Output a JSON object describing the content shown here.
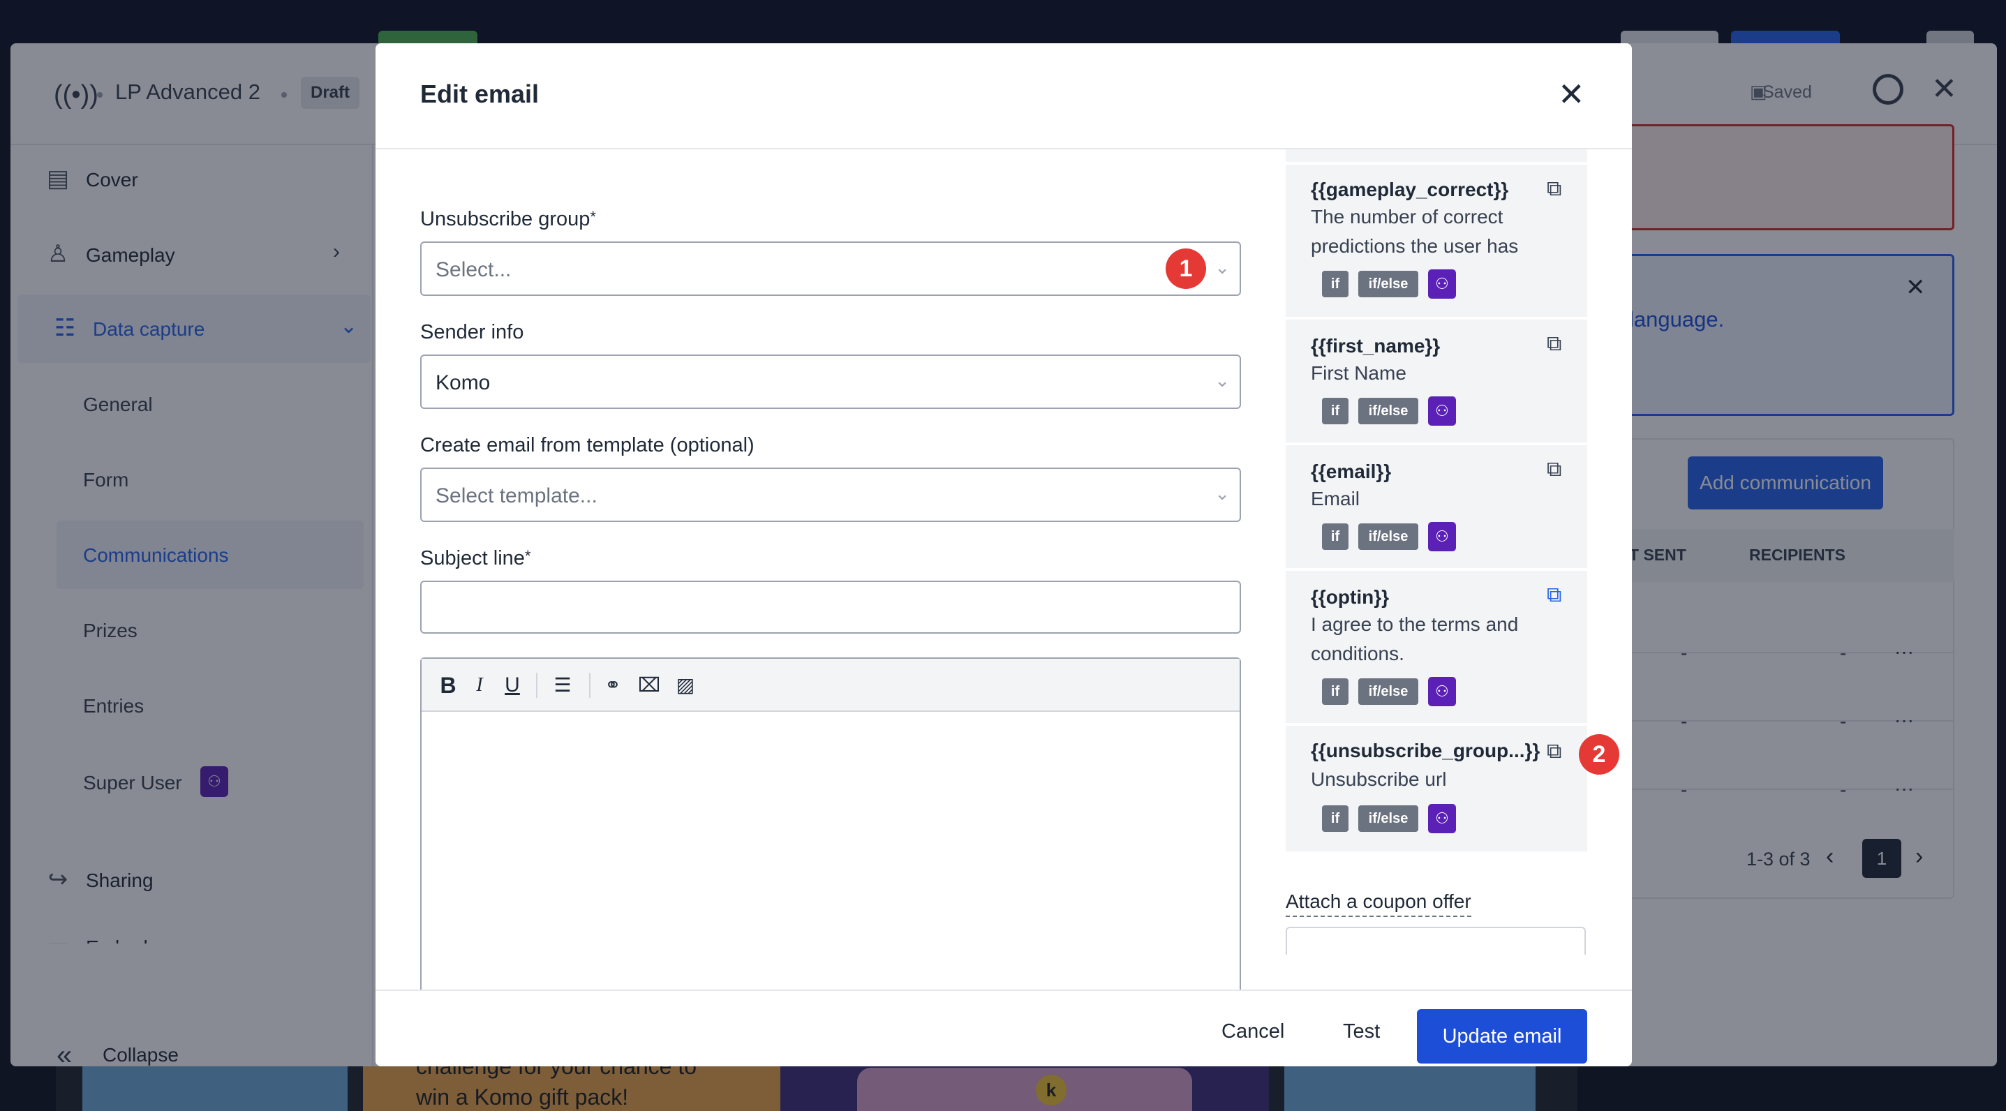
{
  "background": {
    "preview_text_line1": "challenge for your chance to",
    "preview_text_line2": "win a Komo gift pack!",
    "preview_badge": "k"
  },
  "panel": {
    "title": "LP Advanced 2",
    "status_badge": "Draft",
    "saved_label": "Saved",
    "sidebar": {
      "cover": "Cover",
      "gameplay": "Gameplay",
      "data_capture": "Data capture",
      "sub_items": [
        "General",
        "Form",
        "Communications",
        "Prizes",
        "Entries",
        "Super User"
      ],
      "sharing": "Sharing",
      "embed": "Embed",
      "collapse": "Collapse"
    },
    "alert_text": "language.",
    "add_communication": "Add communication",
    "columns": [
      "T SENT",
      "RECIPIENTS"
    ],
    "rows": [
      {
        "sent": "-",
        "recipients": "-",
        "more": "···"
      },
      {
        "sent": "-",
        "recipients": "-",
        "more": "···"
      },
      {
        "sent": "-",
        "recipients": "-",
        "more": "···"
      }
    ],
    "pagination": {
      "summary": "1-3 of 3",
      "current": "1"
    }
  },
  "modal": {
    "title": "Edit email",
    "unsubscribe_group": {
      "label": "Unsubscribe group",
      "required": "*",
      "placeholder": "Select..."
    },
    "sender_info": {
      "label": "Sender info",
      "value": "Komo"
    },
    "template": {
      "label": "Create email from template (optional)",
      "placeholder": "Select template..."
    },
    "subject_line": {
      "label": "Subject line",
      "required": "*",
      "value": ""
    },
    "toolbar": {
      "bold": "B",
      "italic": "I",
      "underline": "U"
    },
    "variables": [
      {
        "name": "{{gameplay_correct}}",
        "desc": "The number of correct predictions the user has",
        "tag_if": "if",
        "tag_ifelse": "if/else"
      },
      {
        "name": "{{first_name}}",
        "desc": "First Name",
        "tag_if": "if",
        "tag_ifelse": "if/else"
      },
      {
        "name": "{{email}}",
        "desc": "Email",
        "tag_if": "if",
        "tag_ifelse": "if/else"
      },
      {
        "name": "{{optin}}",
        "desc": "I agree to the terms and conditions.",
        "tag_if": "if",
        "tag_ifelse": "if/else"
      },
      {
        "name": "{{unsubscribe_group...}}",
        "desc": "Unsubscribe url",
        "tag_if": "if",
        "tag_ifelse": "if/else"
      }
    ],
    "coupon_label": "Attach a coupon offer",
    "footer": {
      "cancel": "Cancel",
      "test": "Test",
      "update": "Update email"
    }
  },
  "markers": {
    "one": "1",
    "two": "2"
  },
  "colors": {
    "primary": "#1d4ed8",
    "accent_blue": "#2563eb",
    "super_user_purple": "#5b21b6",
    "marker_red": "#e53935"
  },
  "icons": {
    "brand": "broadcast-icon",
    "saved": "save-icon",
    "help": "lifebuoy-icon",
    "close": "close-icon",
    "copy": "copy-icon",
    "super_user": "user-badge-icon"
  }
}
